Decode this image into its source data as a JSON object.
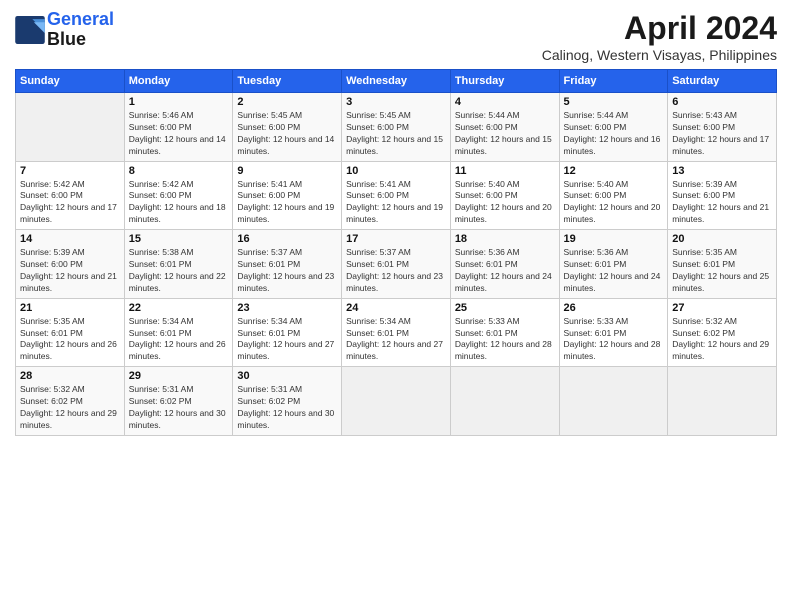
{
  "logo": {
    "line1": "General",
    "line2": "Blue"
  },
  "title": "April 2024",
  "subtitle": "Calinog, Western Visayas, Philippines",
  "weekdays": [
    "Sunday",
    "Monday",
    "Tuesday",
    "Wednesday",
    "Thursday",
    "Friday",
    "Saturday"
  ],
  "weeks": [
    [
      {
        "day": "",
        "sunrise": "",
        "sunset": "",
        "daylight": ""
      },
      {
        "day": "1",
        "sunrise": "5:46 AM",
        "sunset": "6:00 PM",
        "daylight": "12 hours and 14 minutes."
      },
      {
        "day": "2",
        "sunrise": "5:45 AM",
        "sunset": "6:00 PM",
        "daylight": "12 hours and 14 minutes."
      },
      {
        "day": "3",
        "sunrise": "5:45 AM",
        "sunset": "6:00 PM",
        "daylight": "12 hours and 15 minutes."
      },
      {
        "day": "4",
        "sunrise": "5:44 AM",
        "sunset": "6:00 PM",
        "daylight": "12 hours and 15 minutes."
      },
      {
        "day": "5",
        "sunrise": "5:44 AM",
        "sunset": "6:00 PM",
        "daylight": "12 hours and 16 minutes."
      },
      {
        "day": "6",
        "sunrise": "5:43 AM",
        "sunset": "6:00 PM",
        "daylight": "12 hours and 17 minutes."
      }
    ],
    [
      {
        "day": "7",
        "sunrise": "5:42 AM",
        "sunset": "6:00 PM",
        "daylight": "12 hours and 17 minutes."
      },
      {
        "day": "8",
        "sunrise": "5:42 AM",
        "sunset": "6:00 PM",
        "daylight": "12 hours and 18 minutes."
      },
      {
        "day": "9",
        "sunrise": "5:41 AM",
        "sunset": "6:00 PM",
        "daylight": "12 hours and 19 minutes."
      },
      {
        "day": "10",
        "sunrise": "5:41 AM",
        "sunset": "6:00 PM",
        "daylight": "12 hours and 19 minutes."
      },
      {
        "day": "11",
        "sunrise": "5:40 AM",
        "sunset": "6:00 PM",
        "daylight": "12 hours and 20 minutes."
      },
      {
        "day": "12",
        "sunrise": "5:40 AM",
        "sunset": "6:00 PM",
        "daylight": "12 hours and 20 minutes."
      },
      {
        "day": "13",
        "sunrise": "5:39 AM",
        "sunset": "6:00 PM",
        "daylight": "12 hours and 21 minutes."
      }
    ],
    [
      {
        "day": "14",
        "sunrise": "5:39 AM",
        "sunset": "6:00 PM",
        "daylight": "12 hours and 21 minutes."
      },
      {
        "day": "15",
        "sunrise": "5:38 AM",
        "sunset": "6:01 PM",
        "daylight": "12 hours and 22 minutes."
      },
      {
        "day": "16",
        "sunrise": "5:37 AM",
        "sunset": "6:01 PM",
        "daylight": "12 hours and 23 minutes."
      },
      {
        "day": "17",
        "sunrise": "5:37 AM",
        "sunset": "6:01 PM",
        "daylight": "12 hours and 23 minutes."
      },
      {
        "day": "18",
        "sunrise": "5:36 AM",
        "sunset": "6:01 PM",
        "daylight": "12 hours and 24 minutes."
      },
      {
        "day": "19",
        "sunrise": "5:36 AM",
        "sunset": "6:01 PM",
        "daylight": "12 hours and 24 minutes."
      },
      {
        "day": "20",
        "sunrise": "5:35 AM",
        "sunset": "6:01 PM",
        "daylight": "12 hours and 25 minutes."
      }
    ],
    [
      {
        "day": "21",
        "sunrise": "5:35 AM",
        "sunset": "6:01 PM",
        "daylight": "12 hours and 26 minutes."
      },
      {
        "day": "22",
        "sunrise": "5:34 AM",
        "sunset": "6:01 PM",
        "daylight": "12 hours and 26 minutes."
      },
      {
        "day": "23",
        "sunrise": "5:34 AM",
        "sunset": "6:01 PM",
        "daylight": "12 hours and 27 minutes."
      },
      {
        "day": "24",
        "sunrise": "5:34 AM",
        "sunset": "6:01 PM",
        "daylight": "12 hours and 27 minutes."
      },
      {
        "day": "25",
        "sunrise": "5:33 AM",
        "sunset": "6:01 PM",
        "daylight": "12 hours and 28 minutes."
      },
      {
        "day": "26",
        "sunrise": "5:33 AM",
        "sunset": "6:01 PM",
        "daylight": "12 hours and 28 minutes."
      },
      {
        "day": "27",
        "sunrise": "5:32 AM",
        "sunset": "6:02 PM",
        "daylight": "12 hours and 29 minutes."
      }
    ],
    [
      {
        "day": "28",
        "sunrise": "5:32 AM",
        "sunset": "6:02 PM",
        "daylight": "12 hours and 29 minutes."
      },
      {
        "day": "29",
        "sunrise": "5:31 AM",
        "sunset": "6:02 PM",
        "daylight": "12 hours and 30 minutes."
      },
      {
        "day": "30",
        "sunrise": "5:31 AM",
        "sunset": "6:02 PM",
        "daylight": "12 hours and 30 minutes."
      },
      {
        "day": "",
        "sunrise": "",
        "sunset": "",
        "daylight": ""
      },
      {
        "day": "",
        "sunrise": "",
        "sunset": "",
        "daylight": ""
      },
      {
        "day": "",
        "sunrise": "",
        "sunset": "",
        "daylight": ""
      },
      {
        "day": "",
        "sunrise": "",
        "sunset": "",
        "daylight": ""
      }
    ]
  ]
}
